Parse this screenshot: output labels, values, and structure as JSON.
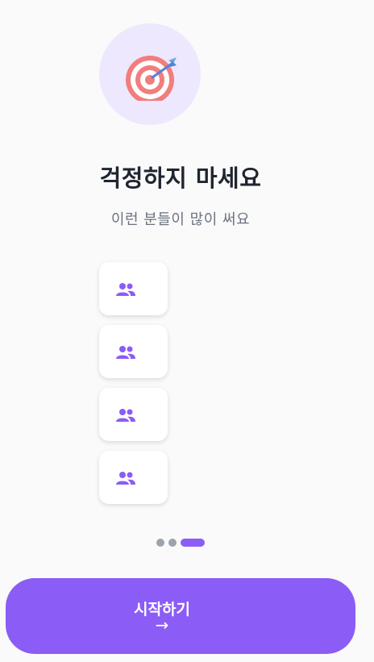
{
  "hero": {
    "icon": "target-dart-icon",
    "circle_color": "#ede8fd"
  },
  "title": "걱정하지 마세요",
  "subtitle": "이런 분들이 많이 써요",
  "cards": [
    {
      "icon": "people-icon"
    },
    {
      "icon": "people-icon"
    },
    {
      "icon": "people-icon"
    },
    {
      "icon": "people-icon"
    }
  ],
  "pagination": {
    "total": 3,
    "active_index": 2
  },
  "cta": {
    "label": "시작하기",
    "arrow": "→",
    "color": "#8b5cf6"
  },
  "colors": {
    "accent": "#8b5cf6",
    "title": "#1f2530",
    "subtitle": "#6b7280",
    "dot_inactive": "#9ca3af"
  }
}
